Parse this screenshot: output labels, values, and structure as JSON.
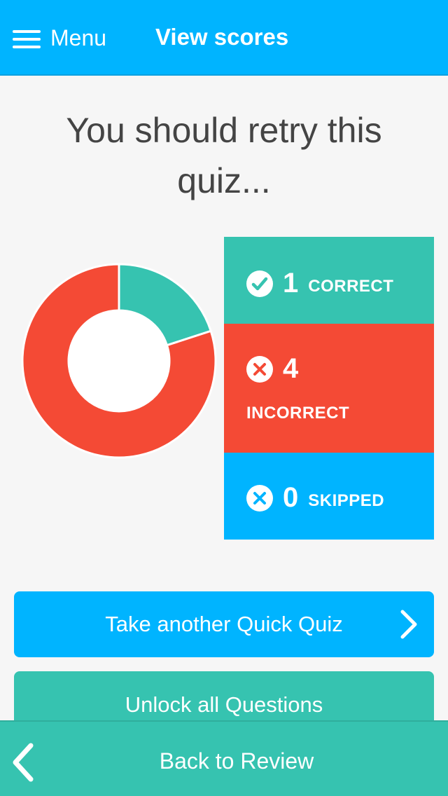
{
  "topbar": {
    "menu_label": "Menu",
    "title": "View scores",
    "color": "#00b4ff"
  },
  "headline": "You should retry this quiz...",
  "results": {
    "correct": {
      "count": "1",
      "label": "CORRECT",
      "icon": "check-circle-icon",
      "color": "#36c3b0"
    },
    "incorrect": {
      "count": "4",
      "label": "INCORRECT",
      "icon": "x-circle-icon",
      "color": "#f44a35"
    },
    "skipped": {
      "count": "0",
      "label": "SKIPPED",
      "icon": "x-circle-icon",
      "color": "#00b4ff"
    }
  },
  "chart_data": {
    "type": "pie",
    "donut": true,
    "title": "",
    "categories": [
      "Correct",
      "Incorrect",
      "Skipped"
    ],
    "values": [
      1,
      4,
      0
    ],
    "colors": [
      "#36c3b0",
      "#f44a35",
      "#00b4ff"
    ]
  },
  "buttons": {
    "take_quiz": "Take another Quick Quiz",
    "unlock": "Unlock all Questions"
  },
  "bottombar": {
    "back_label": "Back to Review",
    "color": "#36c3b0"
  }
}
